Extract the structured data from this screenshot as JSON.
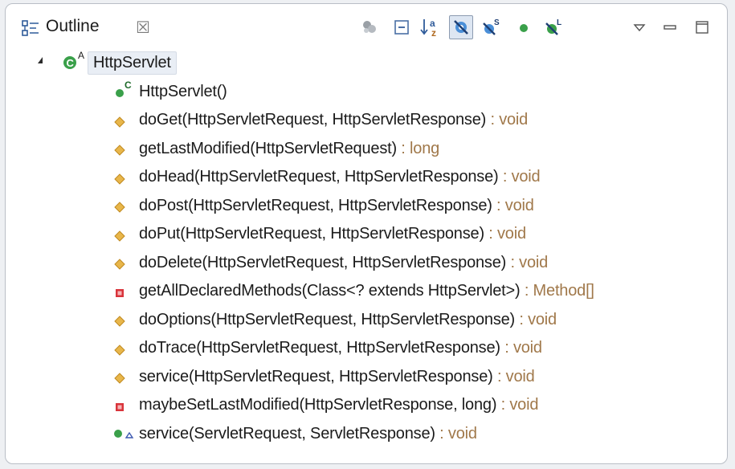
{
  "view": {
    "title": "Outline",
    "close_glyph": "☒",
    "icon": "outline-view-icon"
  },
  "toolbar": {
    "items": [
      {
        "name": "focus-active-task-icon",
        "pressed": false
      },
      {
        "name": "collapse-all-icon",
        "pressed": false
      },
      {
        "name": "sort-alphabetically-icon",
        "pressed": false,
        "label": "a z"
      },
      {
        "name": "hide-fields-icon",
        "pressed": true
      },
      {
        "name": "hide-static-members-icon",
        "pressed": false,
        "label": "S"
      },
      {
        "name": "hide-non-public-members-icon",
        "pressed": false
      },
      {
        "name": "hide-local-types-icon",
        "pressed": false,
        "label": "L"
      },
      {
        "name": "view-menu-icon",
        "pressed": false
      },
      {
        "name": "minimize-icon",
        "pressed": false
      },
      {
        "name": "maximize-icon",
        "pressed": false
      }
    ]
  },
  "tree": {
    "root": {
      "label": "HttpServlet",
      "icon": "abstract-class-icon",
      "badge": "A",
      "expanded": true
    },
    "members": [
      {
        "signature": "HttpServlet()",
        "return": "",
        "icon": "public-constructor-icon",
        "badge": "C"
      },
      {
        "signature": "doGet(HttpServletRequest, HttpServletResponse)",
        "return": " : void",
        "icon": "protected-method-icon"
      },
      {
        "signature": "getLastModified(HttpServletRequest)",
        "return": " : long",
        "icon": "protected-method-icon"
      },
      {
        "signature": "doHead(HttpServletRequest, HttpServletResponse)",
        "return": " : void",
        "icon": "protected-method-icon"
      },
      {
        "signature": "doPost(HttpServletRequest, HttpServletResponse)",
        "return": " : void",
        "icon": "protected-method-icon"
      },
      {
        "signature": "doPut(HttpServletRequest, HttpServletResponse)",
        "return": " : void",
        "icon": "protected-method-icon"
      },
      {
        "signature": "doDelete(HttpServletRequest, HttpServletResponse)",
        "return": " : void",
        "icon": "protected-method-icon"
      },
      {
        "signature": "getAllDeclaredMethods(Class<? extends HttpServlet>)",
        "return": " : Method[]",
        "icon": "private-method-icon"
      },
      {
        "signature": "doOptions(HttpServletRequest, HttpServletResponse)",
        "return": " : void",
        "icon": "protected-method-icon"
      },
      {
        "signature": "doTrace(HttpServletRequest, HttpServletResponse)",
        "return": " : void",
        "icon": "protected-method-icon"
      },
      {
        "signature": "service(HttpServletRequest, HttpServletResponse)",
        "return": " : void",
        "icon": "protected-method-icon"
      },
      {
        "signature": "maybeSetLastModified(HttpServletResponse, long)",
        "return": " : void",
        "icon": "private-method-icon"
      },
      {
        "signature": "service(ServletRequest, ServletResponse)",
        "return": " : void",
        "icon": "public-override-method-icon"
      }
    ]
  },
  "colors": {
    "public": "#3aa04a",
    "protected": "#e8b64a",
    "private": "#d9343b",
    "return_type": "#a0784a",
    "override_triangle": "#3c58b0"
  }
}
